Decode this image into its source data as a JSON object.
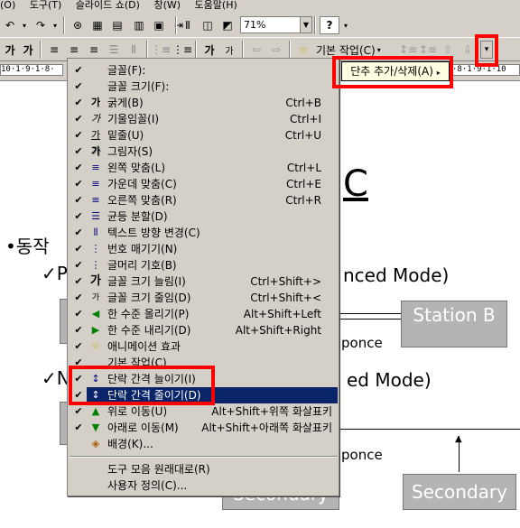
{
  "menubar": {
    "items": [
      "(O)",
      "도구(T)",
      "슬라이드 쇼(D)",
      "창(W)",
      "도움말(H)"
    ]
  },
  "toolbar1": {
    "zoom": "71%",
    "help_label": "?"
  },
  "toolbar2": {
    "bold": "가",
    "bold2": "가",
    "increase_font": "가",
    "decrease_font": "가",
    "common_tasks": "기본 작업(C)"
  },
  "ruler": {
    "scale": "10·1·9·1·8·"
  },
  "tooltip": {
    "text": "단추 추가/삭제(A)"
  },
  "slide": {
    "title_fragment": "C",
    "bullet1": "•동작",
    "sub1_prefix": "✓P",
    "sub1_suffix": "nced Mode)",
    "sub2_prefix": "✓N",
    "sub2_suffix": "ed Mode)",
    "station_b": "Station B",
    "responce1": "ponce",
    "responce2": "ponce",
    "secondary1": "Secondary",
    "secondary2": "Secondary"
  },
  "menu": {
    "items": [
      {
        "label": "글꼴(F):",
        "shortcut": "",
        "icon": "",
        "checked": true
      },
      {
        "label": "글꼴 크기(F):",
        "shortcut": "",
        "icon": "",
        "checked": true
      },
      {
        "label": "굵게(B)",
        "shortcut": "Ctrl+B",
        "icon": "가",
        "checked": true
      },
      {
        "label": "기울임꼴(I)",
        "shortcut": "Ctrl+I",
        "icon": "가",
        "checked": true
      },
      {
        "label": "밑줄(U)",
        "shortcut": "Ctrl+U",
        "icon": "가",
        "checked": true
      },
      {
        "label": "그림자(S)",
        "shortcut": "",
        "icon": "가",
        "checked": true
      },
      {
        "label": "왼쪽 맞춤(L)",
        "shortcut": "Ctrl+L",
        "icon": "≡",
        "checked": true
      },
      {
        "label": "가운데 맞춤(C)",
        "shortcut": "Ctrl+E",
        "icon": "≡",
        "checked": true
      },
      {
        "label": "오른쪽 맞춤(R)",
        "shortcut": "Ctrl+R",
        "icon": "≡",
        "checked": true
      },
      {
        "label": "균등 분할(D)",
        "shortcut": "",
        "icon": "☰",
        "checked": true
      },
      {
        "label": "텍스트 방향 변경(C)",
        "shortcut": "",
        "icon": "⫴",
        "checked": true
      },
      {
        "label": "번호 매기기(N)",
        "shortcut": "",
        "icon": "⋮",
        "checked": true
      },
      {
        "label": "글머리 기호(B)",
        "shortcut": "",
        "icon": "⋮",
        "checked": true
      },
      {
        "label": "글꼴 크기 늘림(I)",
        "shortcut": "Ctrl+Shift+>",
        "icon": "가",
        "checked": true
      },
      {
        "label": "글꼴 크기 줄임(D)",
        "shortcut": "Ctrl+Shift+<",
        "icon": "가",
        "checked": true
      },
      {
        "label": "한 수준 올리기(P)",
        "shortcut": "Alt+Shift+Left",
        "icon": "◀",
        "checked": true
      },
      {
        "label": "한 수준 내리기(D)",
        "shortcut": "Alt+Shift+Right",
        "icon": "▶",
        "checked": true
      },
      {
        "label": "애니메이션 효과",
        "shortcut": "",
        "icon": "☆",
        "checked": true
      },
      {
        "label": "기본 작업(C)",
        "shortcut": "",
        "icon": "",
        "checked": true
      },
      {
        "label": "단락 간격 늘이기(I)",
        "shortcut": "",
        "icon": "↕",
        "checked": true
      },
      {
        "label": "단락 간격 줄이기(D)",
        "shortcut": "",
        "icon": "↕",
        "checked": true
      },
      {
        "label": "위로 이동(U)",
        "shortcut": "Alt+Shift+위쪽 화살표키",
        "icon": "▲",
        "checked": true
      },
      {
        "label": "아래로 이동(M)",
        "shortcut": "Alt+Shift+아래쪽 화살표키",
        "icon": "▼",
        "checked": true
      },
      {
        "label": "배경(K)...",
        "shortcut": "",
        "icon": "◈",
        "checked": false
      }
    ],
    "reset_label": "도구 모음 원래대로(R)",
    "customize_label": "사용자 정의(C)..."
  }
}
